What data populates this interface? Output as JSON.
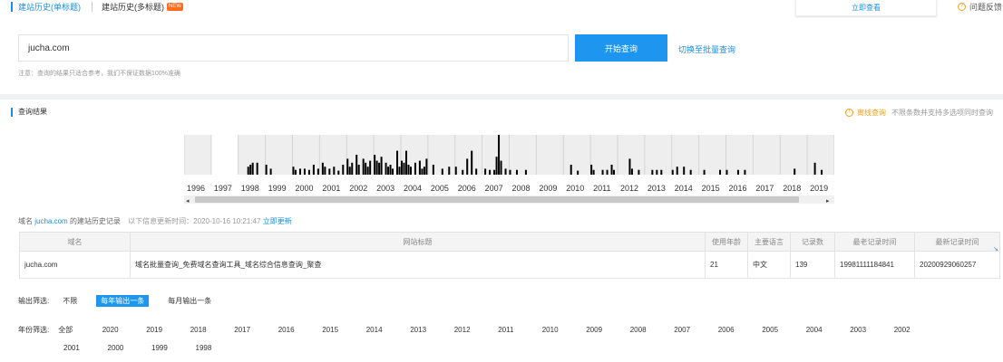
{
  "tabs": [
    {
      "label": "建站历史(单标题)"
    },
    {
      "label": "建站历史(多标题)",
      "badge": "NEW"
    }
  ],
  "top_right": {
    "view_now": "立即查看",
    "feedback": "问题反馈"
  },
  "search": {
    "value": "jucha.com",
    "button": "开始查询",
    "batch_link": "切换至批量查询",
    "note": "注意：查询的结果只适合参考，我们不保证数据100%准确"
  },
  "results": {
    "title": "查询结果",
    "offline_link": "离线查询",
    "offline_desc": "不限条数并支持多选项同时查询"
  },
  "chart_data": {
    "type": "bar",
    "x_years": [
      "1996",
      "1997",
      "1998",
      "1999",
      "2000",
      "2001",
      "2002",
      "2003",
      "2004",
      "2005",
      "2006",
      "2007",
      "2008",
      "2009",
      "2010",
      "2011",
      "2012",
      "2013",
      "2014",
      "2015",
      "2016",
      "2017",
      "2018",
      "2019"
    ],
    "grid": true,
    "bars": [
      {
        "year": 1998,
        "months": [
          5,
          6,
          7,
          9
        ],
        "values": [
          0.2,
          0.25,
          0.3,
          0.3
        ]
      },
      {
        "year": 1999,
        "months": [
          1,
          3
        ],
        "values": [
          0.25,
          0.15
        ]
      },
      {
        "year": 2000,
        "months": [
          1,
          2,
          4,
          6,
          8,
          10,
          12
        ],
        "values": [
          0.2,
          0.12,
          0.15,
          0.15,
          0.12,
          0.25,
          0.15
        ]
      },
      {
        "year": 2001,
        "months": [
          2,
          3,
          5,
          7,
          9,
          11
        ],
        "values": [
          0.3,
          0.2,
          0.15,
          0.2,
          0.1,
          0.25
        ]
      },
      {
        "year": 2002,
        "months": [
          1,
          2,
          3,
          5,
          6,
          8,
          9,
          10,
          11
        ],
        "values": [
          0.4,
          0.2,
          0.3,
          0.5,
          0.25,
          0.4,
          0.3,
          0.2,
          0.35
        ]
      },
      {
        "year": 2003,
        "months": [
          1,
          2,
          3,
          4,
          6,
          7,
          8,
          9,
          11,
          12
        ],
        "values": [
          0.5,
          0.35,
          0.3,
          0.45,
          0.3,
          0.2,
          0.25,
          0.15,
          0.6,
          0.2
        ]
      },
      {
        "year": 2004,
        "months": [
          1,
          2,
          3,
          4,
          5,
          7,
          9,
          10,
          11,
          12
        ],
        "values": [
          0.35,
          0.3,
          0.6,
          0.25,
          0.2,
          0.3,
          0.35,
          0.15,
          0.2,
          0.4
        ]
      },
      {
        "year": 2005,
        "months": [
          3,
          7,
          10
        ],
        "values": [
          0.25,
          0.15,
          0.2
        ]
      },
      {
        "year": 2006,
        "months": [
          1,
          4,
          6,
          8,
          10
        ],
        "values": [
          0.2,
          0.12,
          0.4,
          0.6,
          0.15
        ]
      },
      {
        "year": 2007,
        "months": [
          2,
          4,
          6,
          7,
          8,
          9,
          11
        ],
        "values": [
          0.15,
          0.12,
          0.12,
          0.45,
          1.0,
          0.35,
          0.15
        ]
      },
      {
        "year": 2008,
        "months": [
          1,
          4,
          8
        ],
        "values": [
          0.12,
          0.12,
          0.12
        ]
      },
      {
        "year": 2010,
        "months": [
          4,
          7
        ],
        "values": [
          0.25,
          0.1
        ]
      },
      {
        "year": 2011,
        "months": [
          1,
          2,
          6,
          8,
          10,
          11
        ],
        "values": [
          0.25,
          0.12,
          0.12,
          0.12,
          0.25,
          0.12
        ]
      },
      {
        "year": 2012,
        "months": [
          6,
          7,
          10
        ],
        "values": [
          0.4,
          0.15,
          0.12
        ]
      },
      {
        "year": 2013,
        "months": [
          4,
          6,
          8
        ],
        "values": [
          0.12,
          0.12,
          0.12
        ]
      },
      {
        "year": 2014,
        "months": [
          1,
          3,
          6,
          9
        ],
        "values": [
          0.12,
          0.2,
          0.2,
          0.12
        ]
      },
      {
        "year": 2015,
        "months": [
          3,
          10
        ],
        "values": [
          0.12,
          0.12
        ]
      },
      {
        "year": 2016,
        "months": [
          1,
          6,
          9
        ],
        "values": [
          0.12,
          0.12,
          0.12
        ]
      },
      {
        "year": 2018,
        "months": [
          7
        ],
        "values": [
          0.15
        ]
      },
      {
        "year": 2019,
        "months": [
          4,
          7
        ],
        "values": [
          0.3,
          0.12
        ]
      }
    ]
  },
  "domain_info": {
    "prefix": "域名",
    "domain": "jucha.com",
    "suffix": "的建站历史记录",
    "updated": "以下信息更新时间：2020-10-16 10:21:47",
    "refresh": "立即更新"
  },
  "table": {
    "headers": [
      "域名",
      "网站标题",
      "使用年龄",
      "主要语言",
      "记录数",
      "最老记录时间",
      "最新记录时间"
    ],
    "row": [
      "jucha.com",
      "域名批量查询_免费域名查询工具_域名综合信息查询_聚查",
      "21",
      "中文",
      "139",
      "19981111184841",
      "20200929060257"
    ]
  },
  "output_filter": {
    "label": "输出筛选:",
    "options": [
      "不限",
      "每年输出一条",
      "每月输出一条"
    ],
    "active_index": 1
  },
  "year_filter": {
    "label": "年份筛选:",
    "row1": [
      "全部",
      "2020",
      "2019",
      "2018",
      "2017",
      "2016",
      "2015",
      "2014",
      "2013",
      "2012",
      "2011",
      "2010",
      "2009",
      "2008",
      "2007",
      "2006",
      "2005",
      "2004",
      "2003",
      "2002"
    ],
    "row2": [
      "2001",
      "2000",
      "1999",
      "1998"
    ]
  }
}
